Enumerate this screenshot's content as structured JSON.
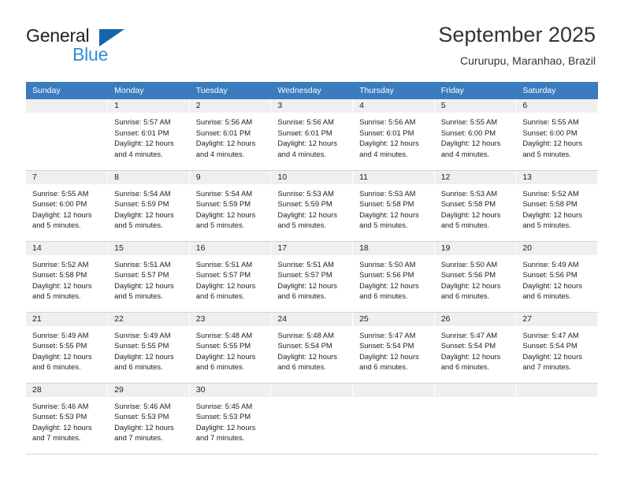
{
  "brand": {
    "name_part1": "General",
    "name_part2": "Blue",
    "triangle_color": "#1565a8",
    "blue_color": "#2d8fd5"
  },
  "header": {
    "title": "September 2025",
    "subtitle": "Cururupu, Maranhao, Brazil"
  },
  "theme": {
    "header_row_bg": "#3a7cbe",
    "header_row_text": "#ffffff",
    "daynum_bg": "#efefef",
    "cell_border": "#d4d4d4",
    "text_color": "#222222"
  },
  "labels": {
    "sunrise_prefix": "Sunrise:",
    "sunset_prefix": "Sunset:",
    "daylight_prefix": "Daylight:"
  },
  "weekdays": [
    "Sunday",
    "Monday",
    "Tuesday",
    "Wednesday",
    "Thursday",
    "Friday",
    "Saturday"
  ],
  "weeks": [
    [
      {
        "day": "",
        "sunrise": "",
        "sunset": "",
        "daylight_line1": "",
        "daylight_line2": "",
        "empty": true
      },
      {
        "day": "1",
        "sunrise": "Sunrise: 5:57 AM",
        "sunset": "Sunset: 6:01 PM",
        "daylight_line1": "Daylight: 12 hours",
        "daylight_line2": "and 4 minutes."
      },
      {
        "day": "2",
        "sunrise": "Sunrise: 5:56 AM",
        "sunset": "Sunset: 6:01 PM",
        "daylight_line1": "Daylight: 12 hours",
        "daylight_line2": "and 4 minutes."
      },
      {
        "day": "3",
        "sunrise": "Sunrise: 5:56 AM",
        "sunset": "Sunset: 6:01 PM",
        "daylight_line1": "Daylight: 12 hours",
        "daylight_line2": "and 4 minutes."
      },
      {
        "day": "4",
        "sunrise": "Sunrise: 5:56 AM",
        "sunset": "Sunset: 6:01 PM",
        "daylight_line1": "Daylight: 12 hours",
        "daylight_line2": "and 4 minutes."
      },
      {
        "day": "5",
        "sunrise": "Sunrise: 5:55 AM",
        "sunset": "Sunset: 6:00 PM",
        "daylight_line1": "Daylight: 12 hours",
        "daylight_line2": "and 4 minutes."
      },
      {
        "day": "6",
        "sunrise": "Sunrise: 5:55 AM",
        "sunset": "Sunset: 6:00 PM",
        "daylight_line1": "Daylight: 12 hours",
        "daylight_line2": "and 5 minutes."
      }
    ],
    [
      {
        "day": "7",
        "sunrise": "Sunrise: 5:55 AM",
        "sunset": "Sunset: 6:00 PM",
        "daylight_line1": "Daylight: 12 hours",
        "daylight_line2": "and 5 minutes."
      },
      {
        "day": "8",
        "sunrise": "Sunrise: 5:54 AM",
        "sunset": "Sunset: 5:59 PM",
        "daylight_line1": "Daylight: 12 hours",
        "daylight_line2": "and 5 minutes."
      },
      {
        "day": "9",
        "sunrise": "Sunrise: 5:54 AM",
        "sunset": "Sunset: 5:59 PM",
        "daylight_line1": "Daylight: 12 hours",
        "daylight_line2": "and 5 minutes."
      },
      {
        "day": "10",
        "sunrise": "Sunrise: 5:53 AM",
        "sunset": "Sunset: 5:59 PM",
        "daylight_line1": "Daylight: 12 hours",
        "daylight_line2": "and 5 minutes."
      },
      {
        "day": "11",
        "sunrise": "Sunrise: 5:53 AM",
        "sunset": "Sunset: 5:58 PM",
        "daylight_line1": "Daylight: 12 hours",
        "daylight_line2": "and 5 minutes."
      },
      {
        "day": "12",
        "sunrise": "Sunrise: 5:53 AM",
        "sunset": "Sunset: 5:58 PM",
        "daylight_line1": "Daylight: 12 hours",
        "daylight_line2": "and 5 minutes."
      },
      {
        "day": "13",
        "sunrise": "Sunrise: 5:52 AM",
        "sunset": "Sunset: 5:58 PM",
        "daylight_line1": "Daylight: 12 hours",
        "daylight_line2": "and 5 minutes."
      }
    ],
    [
      {
        "day": "14",
        "sunrise": "Sunrise: 5:52 AM",
        "sunset": "Sunset: 5:58 PM",
        "daylight_line1": "Daylight: 12 hours",
        "daylight_line2": "and 5 minutes."
      },
      {
        "day": "15",
        "sunrise": "Sunrise: 5:51 AM",
        "sunset": "Sunset: 5:57 PM",
        "daylight_line1": "Daylight: 12 hours",
        "daylight_line2": "and 5 minutes."
      },
      {
        "day": "16",
        "sunrise": "Sunrise: 5:51 AM",
        "sunset": "Sunset: 5:57 PM",
        "daylight_line1": "Daylight: 12 hours",
        "daylight_line2": "and 6 minutes."
      },
      {
        "day": "17",
        "sunrise": "Sunrise: 5:51 AM",
        "sunset": "Sunset: 5:57 PM",
        "daylight_line1": "Daylight: 12 hours",
        "daylight_line2": "and 6 minutes."
      },
      {
        "day": "18",
        "sunrise": "Sunrise: 5:50 AM",
        "sunset": "Sunset: 5:56 PM",
        "daylight_line1": "Daylight: 12 hours",
        "daylight_line2": "and 6 minutes."
      },
      {
        "day": "19",
        "sunrise": "Sunrise: 5:50 AM",
        "sunset": "Sunset: 5:56 PM",
        "daylight_line1": "Daylight: 12 hours",
        "daylight_line2": "and 6 minutes."
      },
      {
        "day": "20",
        "sunrise": "Sunrise: 5:49 AM",
        "sunset": "Sunset: 5:56 PM",
        "daylight_line1": "Daylight: 12 hours",
        "daylight_line2": "and 6 minutes."
      }
    ],
    [
      {
        "day": "21",
        "sunrise": "Sunrise: 5:49 AM",
        "sunset": "Sunset: 5:55 PM",
        "daylight_line1": "Daylight: 12 hours",
        "daylight_line2": "and 6 minutes."
      },
      {
        "day": "22",
        "sunrise": "Sunrise: 5:49 AM",
        "sunset": "Sunset: 5:55 PM",
        "daylight_line1": "Daylight: 12 hours",
        "daylight_line2": "and 6 minutes."
      },
      {
        "day": "23",
        "sunrise": "Sunrise: 5:48 AM",
        "sunset": "Sunset: 5:55 PM",
        "daylight_line1": "Daylight: 12 hours",
        "daylight_line2": "and 6 minutes."
      },
      {
        "day": "24",
        "sunrise": "Sunrise: 5:48 AM",
        "sunset": "Sunset: 5:54 PM",
        "daylight_line1": "Daylight: 12 hours",
        "daylight_line2": "and 6 minutes."
      },
      {
        "day": "25",
        "sunrise": "Sunrise: 5:47 AM",
        "sunset": "Sunset: 5:54 PM",
        "daylight_line1": "Daylight: 12 hours",
        "daylight_line2": "and 6 minutes."
      },
      {
        "day": "26",
        "sunrise": "Sunrise: 5:47 AM",
        "sunset": "Sunset: 5:54 PM",
        "daylight_line1": "Daylight: 12 hours",
        "daylight_line2": "and 6 minutes."
      },
      {
        "day": "27",
        "sunrise": "Sunrise: 5:47 AM",
        "sunset": "Sunset: 5:54 PM",
        "daylight_line1": "Daylight: 12 hours",
        "daylight_line2": "and 7 minutes."
      }
    ],
    [
      {
        "day": "28",
        "sunrise": "Sunrise: 5:46 AM",
        "sunset": "Sunset: 5:53 PM",
        "daylight_line1": "Daylight: 12 hours",
        "daylight_line2": "and 7 minutes."
      },
      {
        "day": "29",
        "sunrise": "Sunrise: 5:46 AM",
        "sunset": "Sunset: 5:53 PM",
        "daylight_line1": "Daylight: 12 hours",
        "daylight_line2": "and 7 minutes."
      },
      {
        "day": "30",
        "sunrise": "Sunrise: 5:45 AM",
        "sunset": "Sunset: 5:53 PM",
        "daylight_line1": "Daylight: 12 hours",
        "daylight_line2": "and 7 minutes."
      },
      {
        "day": "",
        "sunrise": "",
        "sunset": "",
        "daylight_line1": "",
        "daylight_line2": "",
        "empty": true
      },
      {
        "day": "",
        "sunrise": "",
        "sunset": "",
        "daylight_line1": "",
        "daylight_line2": "",
        "empty": true
      },
      {
        "day": "",
        "sunrise": "",
        "sunset": "",
        "daylight_line1": "",
        "daylight_line2": "",
        "empty": true
      },
      {
        "day": "",
        "sunrise": "",
        "sunset": "",
        "daylight_line1": "",
        "daylight_line2": "",
        "empty": true
      }
    ]
  ]
}
